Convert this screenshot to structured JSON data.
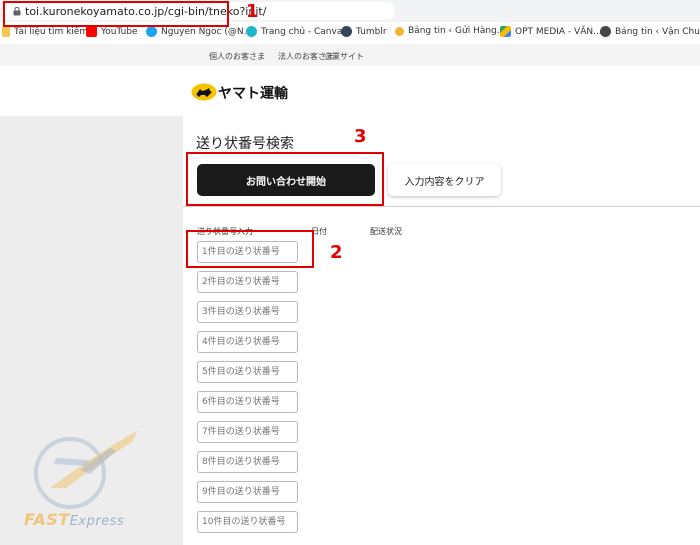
{
  "browser": {
    "url": "toi.kuronekoyamato.co.jp/cgi-bin/tneko?init/"
  },
  "bookmarks": [
    {
      "label": "Tài liệu tìm kiếm",
      "icon": "folder-icon"
    },
    {
      "label": "YouTube",
      "icon": "youtube-icon"
    },
    {
      "label": "Nguyen Ngoc (@N...",
      "icon": "twitter-icon"
    },
    {
      "label": "Trang chủ - Canva",
      "icon": "canva-icon"
    },
    {
      "label": "Tumblr",
      "icon": "tumblr-icon"
    },
    {
      "label": "Bảng tin ‹ Gửi Hàng...",
      "icon": "sun-icon"
    },
    {
      "label": "OPT MEDIA - VĂN...",
      "icon": "drive-icon"
    },
    {
      "label": "Bảng tin ‹ Vận Chuy...",
      "icon": "wordpress-icon"
    }
  ],
  "site_nav": {
    "personal": "個人のお客さま",
    "corporate": "法人のお客さま",
    "company": "企業サイト"
  },
  "logo": {
    "text": "ヤマト運輸"
  },
  "main": {
    "title": "送り状番号検索",
    "start_button": "お問い合わせ開始",
    "clear_button": "入力内容をクリア",
    "columns": {
      "number": "送り状番号入力",
      "date": "日付",
      "status": "配送状況"
    },
    "inputs": [
      "1件目の送り状番号",
      "2件目の送り状番号",
      "3件目の送り状番号",
      "4件目の送り状番号",
      "5件目の送り状番号",
      "6件目の送り状番号",
      "7件目の送り状番号",
      "8件目の送り状番号",
      "9件目の送り状番号",
      "10件目の送り状番号"
    ]
  },
  "annotations": {
    "n1": "1",
    "n2": "2",
    "n3": "3"
  },
  "watermark": {
    "brand": "FAST",
    "sub": "Express"
  },
  "colors": {
    "annotation": "#e00000",
    "button_dark": "#1a1a1a",
    "watermark": "#f0c77a"
  }
}
